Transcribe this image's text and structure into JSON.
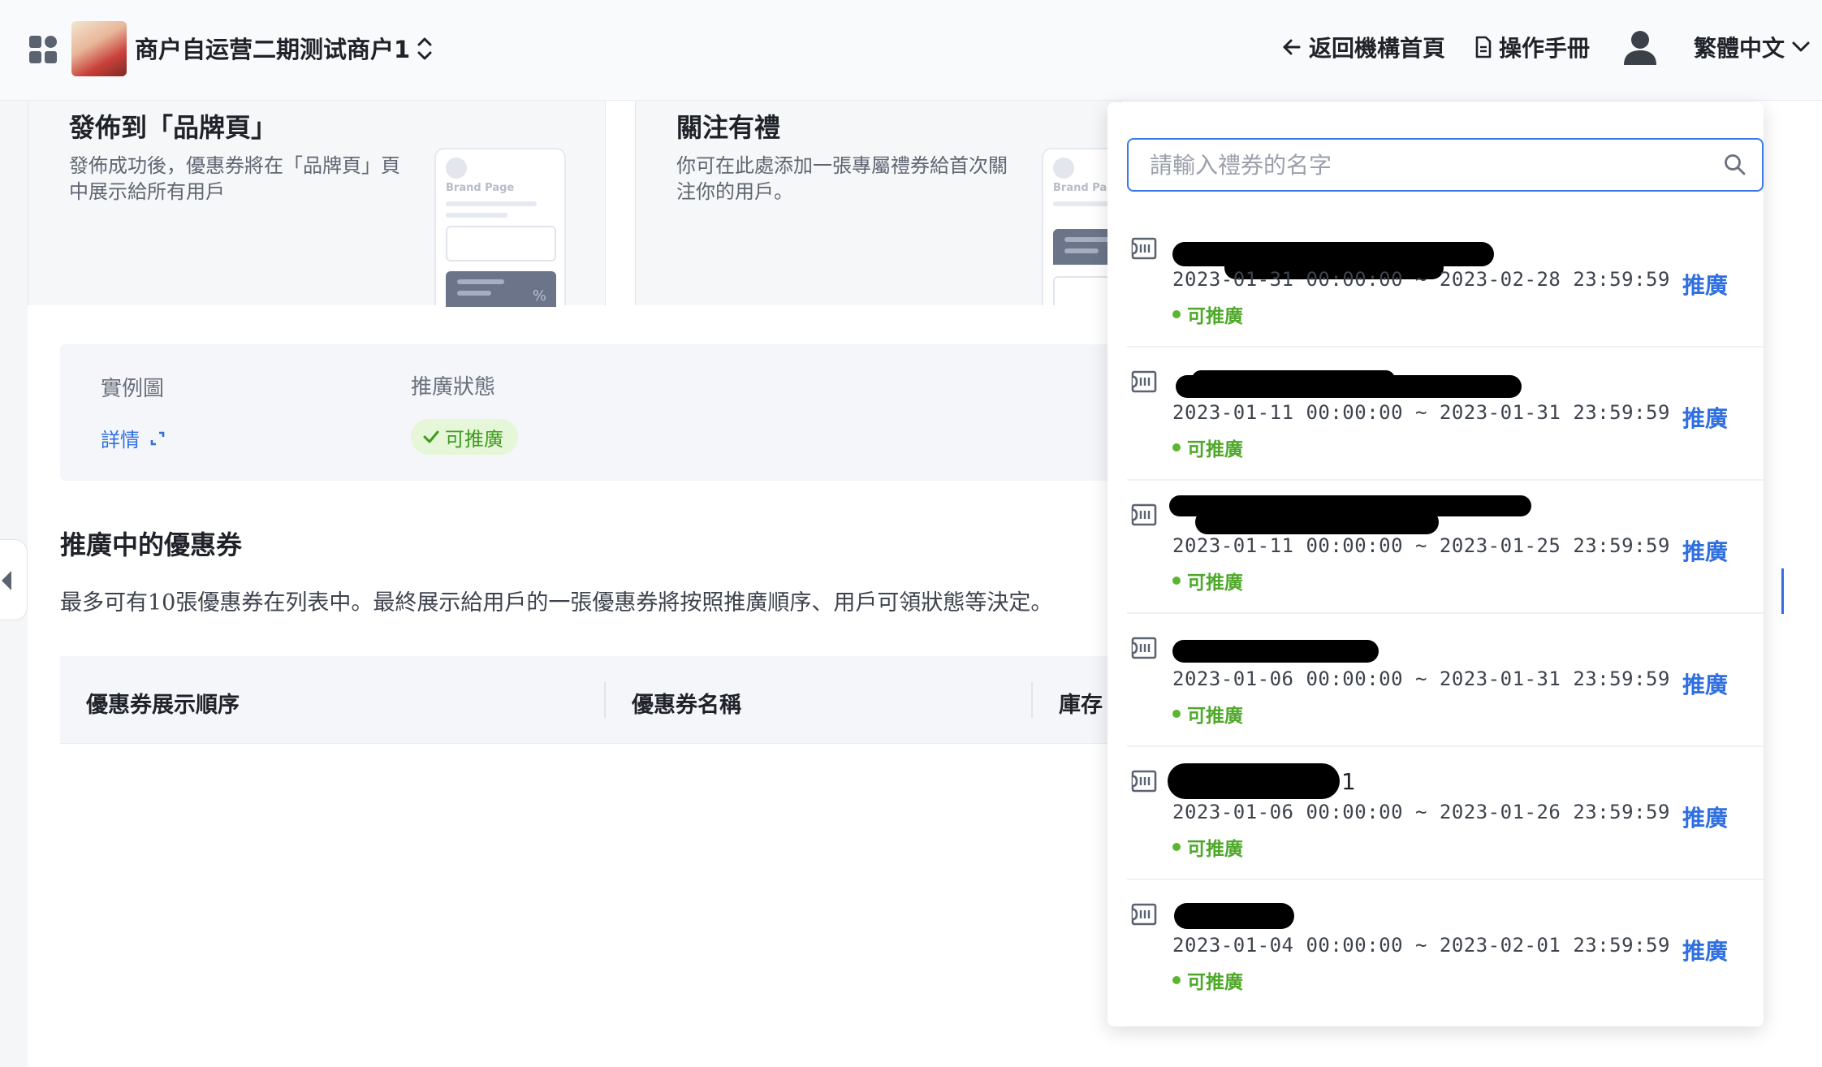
{
  "header": {
    "merchant_name": "商户自运营二期测试商户1",
    "back_link": "返回機構首頁",
    "manual_link": "操作手冊",
    "language": "繁體中文"
  },
  "cards": [
    {
      "title": "發佈到「品牌頁」",
      "desc": "發佈成功後，優惠券將在「品牌頁」頁中展示給所有用戶",
      "phone_label": "Brand Page"
    },
    {
      "title": "關注有禮",
      "desc": "你可在此處添加一張專屬禮券給首次關注你的用戶。",
      "phone_label": "Brand Pag"
    }
  ],
  "info": {
    "example_label": "實例圖",
    "details_link": "詳情",
    "status_label": "推廣狀態",
    "status_value": "可推廣"
  },
  "promoting": {
    "title": "推廣中的優惠券",
    "desc": "最多可有10張優惠券在列表中。最終展示給用戶的一張優惠券將按照推廣順序、用戶可領狀態等決定。"
  },
  "table": {
    "columns": [
      "優惠券展示順序",
      "優惠券名稱",
      "庫存"
    ]
  },
  "dropdown": {
    "search_placeholder": "請輸入禮券的名字",
    "search_value": "",
    "items": [
      {
        "name": "",
        "date": "2023-01-31 00:00:00 ~ 2023-02-28 23:59:59",
        "status": "可推廣",
        "action": "推廣"
      },
      {
        "name": "",
        "date": "2023-01-11 00:00:00 ~ 2023-01-31 23:59:59",
        "status": "可推廣",
        "action": "推廣"
      },
      {
        "name": "",
        "date": "2023-01-11 00:00:00 ~ 2023-01-25 23:59:59",
        "status": "可推廣",
        "action": "推廣"
      },
      {
        "name": "",
        "date": "2023-01-06 00:00:00 ~ 2023-01-31 23:59:59",
        "status": "可推廣",
        "action": "推廣"
      },
      {
        "name": "1",
        "date": "2023-01-06 00:00:00 ~ 2023-01-26 23:59:59",
        "status": "可推廣",
        "action": "推廣"
      },
      {
        "name": "",
        "date": "2023-01-04 00:00:00 ~ 2023-02-01 23:59:59",
        "status": "可推廣",
        "action": "推廣"
      }
    ]
  },
  "colors": {
    "accent": "#2f6fe0",
    "success": "#4fa82a",
    "search_border": "#3b78e7"
  }
}
